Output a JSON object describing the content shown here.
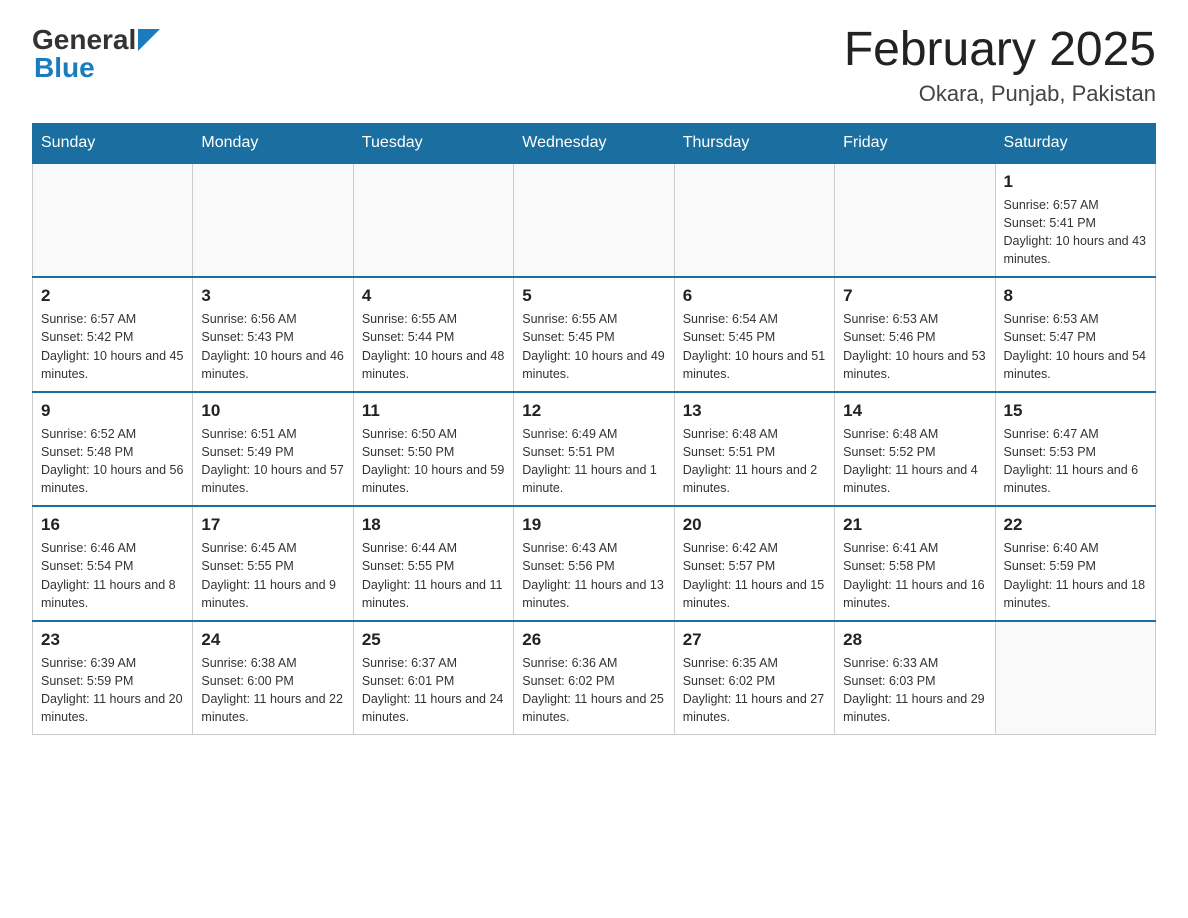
{
  "header": {
    "logo_general": "General",
    "logo_blue": "Blue",
    "month_title": "February 2025",
    "location": "Okara, Punjab, Pakistan"
  },
  "weekdays": [
    "Sunday",
    "Monday",
    "Tuesday",
    "Wednesday",
    "Thursday",
    "Friday",
    "Saturday"
  ],
  "weeks": [
    [
      {
        "day": "",
        "sunrise": "",
        "sunset": "",
        "daylight": ""
      },
      {
        "day": "",
        "sunrise": "",
        "sunset": "",
        "daylight": ""
      },
      {
        "day": "",
        "sunrise": "",
        "sunset": "",
        "daylight": ""
      },
      {
        "day": "",
        "sunrise": "",
        "sunset": "",
        "daylight": ""
      },
      {
        "day": "",
        "sunrise": "",
        "sunset": "",
        "daylight": ""
      },
      {
        "day": "",
        "sunrise": "",
        "sunset": "",
        "daylight": ""
      },
      {
        "day": "1",
        "sunrise": "Sunrise: 6:57 AM",
        "sunset": "Sunset: 5:41 PM",
        "daylight": "Daylight: 10 hours and 43 minutes."
      }
    ],
    [
      {
        "day": "2",
        "sunrise": "Sunrise: 6:57 AM",
        "sunset": "Sunset: 5:42 PM",
        "daylight": "Daylight: 10 hours and 45 minutes."
      },
      {
        "day": "3",
        "sunrise": "Sunrise: 6:56 AM",
        "sunset": "Sunset: 5:43 PM",
        "daylight": "Daylight: 10 hours and 46 minutes."
      },
      {
        "day": "4",
        "sunrise": "Sunrise: 6:55 AM",
        "sunset": "Sunset: 5:44 PM",
        "daylight": "Daylight: 10 hours and 48 minutes."
      },
      {
        "day": "5",
        "sunrise": "Sunrise: 6:55 AM",
        "sunset": "Sunset: 5:45 PM",
        "daylight": "Daylight: 10 hours and 49 minutes."
      },
      {
        "day": "6",
        "sunrise": "Sunrise: 6:54 AM",
        "sunset": "Sunset: 5:45 PM",
        "daylight": "Daylight: 10 hours and 51 minutes."
      },
      {
        "day": "7",
        "sunrise": "Sunrise: 6:53 AM",
        "sunset": "Sunset: 5:46 PM",
        "daylight": "Daylight: 10 hours and 53 minutes."
      },
      {
        "day": "8",
        "sunrise": "Sunrise: 6:53 AM",
        "sunset": "Sunset: 5:47 PM",
        "daylight": "Daylight: 10 hours and 54 minutes."
      }
    ],
    [
      {
        "day": "9",
        "sunrise": "Sunrise: 6:52 AM",
        "sunset": "Sunset: 5:48 PM",
        "daylight": "Daylight: 10 hours and 56 minutes."
      },
      {
        "day": "10",
        "sunrise": "Sunrise: 6:51 AM",
        "sunset": "Sunset: 5:49 PM",
        "daylight": "Daylight: 10 hours and 57 minutes."
      },
      {
        "day": "11",
        "sunrise": "Sunrise: 6:50 AM",
        "sunset": "Sunset: 5:50 PM",
        "daylight": "Daylight: 10 hours and 59 minutes."
      },
      {
        "day": "12",
        "sunrise": "Sunrise: 6:49 AM",
        "sunset": "Sunset: 5:51 PM",
        "daylight": "Daylight: 11 hours and 1 minute."
      },
      {
        "day": "13",
        "sunrise": "Sunrise: 6:48 AM",
        "sunset": "Sunset: 5:51 PM",
        "daylight": "Daylight: 11 hours and 2 minutes."
      },
      {
        "day": "14",
        "sunrise": "Sunrise: 6:48 AM",
        "sunset": "Sunset: 5:52 PM",
        "daylight": "Daylight: 11 hours and 4 minutes."
      },
      {
        "day": "15",
        "sunrise": "Sunrise: 6:47 AM",
        "sunset": "Sunset: 5:53 PM",
        "daylight": "Daylight: 11 hours and 6 minutes."
      }
    ],
    [
      {
        "day": "16",
        "sunrise": "Sunrise: 6:46 AM",
        "sunset": "Sunset: 5:54 PM",
        "daylight": "Daylight: 11 hours and 8 minutes."
      },
      {
        "day": "17",
        "sunrise": "Sunrise: 6:45 AM",
        "sunset": "Sunset: 5:55 PM",
        "daylight": "Daylight: 11 hours and 9 minutes."
      },
      {
        "day": "18",
        "sunrise": "Sunrise: 6:44 AM",
        "sunset": "Sunset: 5:55 PM",
        "daylight": "Daylight: 11 hours and 11 minutes."
      },
      {
        "day": "19",
        "sunrise": "Sunrise: 6:43 AM",
        "sunset": "Sunset: 5:56 PM",
        "daylight": "Daylight: 11 hours and 13 minutes."
      },
      {
        "day": "20",
        "sunrise": "Sunrise: 6:42 AM",
        "sunset": "Sunset: 5:57 PM",
        "daylight": "Daylight: 11 hours and 15 minutes."
      },
      {
        "day": "21",
        "sunrise": "Sunrise: 6:41 AM",
        "sunset": "Sunset: 5:58 PM",
        "daylight": "Daylight: 11 hours and 16 minutes."
      },
      {
        "day": "22",
        "sunrise": "Sunrise: 6:40 AM",
        "sunset": "Sunset: 5:59 PM",
        "daylight": "Daylight: 11 hours and 18 minutes."
      }
    ],
    [
      {
        "day": "23",
        "sunrise": "Sunrise: 6:39 AM",
        "sunset": "Sunset: 5:59 PM",
        "daylight": "Daylight: 11 hours and 20 minutes."
      },
      {
        "day": "24",
        "sunrise": "Sunrise: 6:38 AM",
        "sunset": "Sunset: 6:00 PM",
        "daylight": "Daylight: 11 hours and 22 minutes."
      },
      {
        "day": "25",
        "sunrise": "Sunrise: 6:37 AM",
        "sunset": "Sunset: 6:01 PM",
        "daylight": "Daylight: 11 hours and 24 minutes."
      },
      {
        "day": "26",
        "sunrise": "Sunrise: 6:36 AM",
        "sunset": "Sunset: 6:02 PM",
        "daylight": "Daylight: 11 hours and 25 minutes."
      },
      {
        "day": "27",
        "sunrise": "Sunrise: 6:35 AM",
        "sunset": "Sunset: 6:02 PM",
        "daylight": "Daylight: 11 hours and 27 minutes."
      },
      {
        "day": "28",
        "sunrise": "Sunrise: 6:33 AM",
        "sunset": "Sunset: 6:03 PM",
        "daylight": "Daylight: 11 hours and 29 minutes."
      },
      {
        "day": "",
        "sunrise": "",
        "sunset": "",
        "daylight": ""
      }
    ]
  ]
}
